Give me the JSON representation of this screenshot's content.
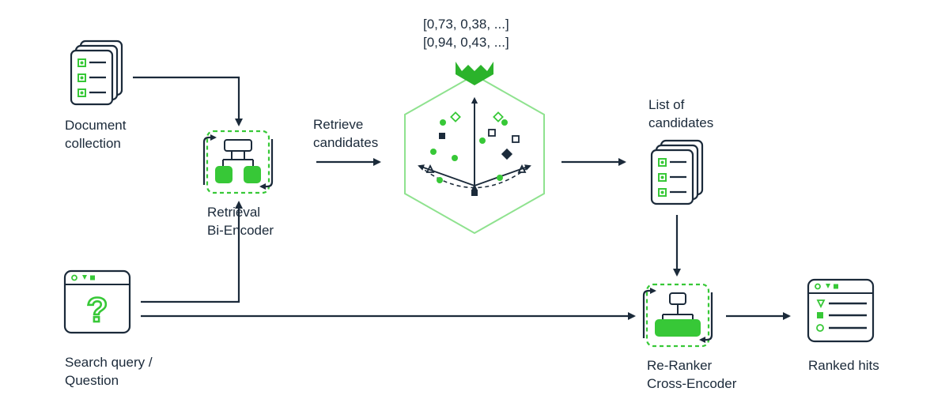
{
  "colors": {
    "ink": "#1b2a3a",
    "accent": "#37c837",
    "accentDark": "#2bb32b"
  },
  "labels": {
    "document_collection": "Document\ncollection",
    "retrieval_bi_encoder": "Retrieval\nBi-Encoder",
    "retrieve_candidates": "Retrieve\ncandidates",
    "vectors_line1": "[0,73, 0,38, ...]",
    "vectors_line2": "[0,94, 0,43, ...]",
    "list_of_candidates": "List of\ncandidates",
    "search_query": "Search query /\nQuestion",
    "re_ranker": "Re-Ranker\nCross-Encoder",
    "ranked_hits": "Ranked hits"
  }
}
